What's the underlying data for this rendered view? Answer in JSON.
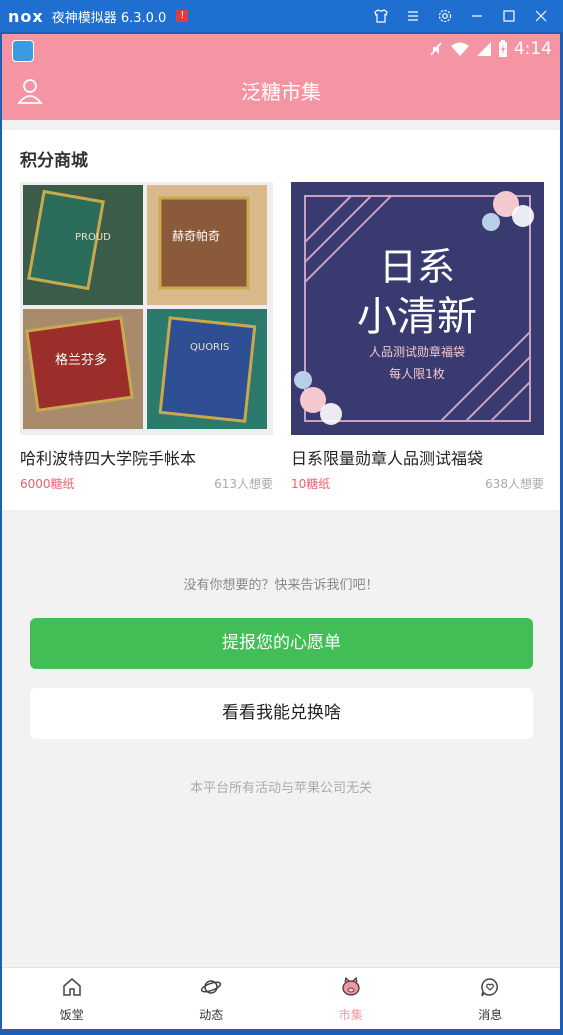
{
  "window": {
    "logo": "nox",
    "title": "夜神模拟器 6.3.0.0",
    "warn": "!",
    "buttons": [
      "shirt-icon",
      "menu-icon",
      "gear-icon",
      "minimize-icon",
      "maximize-icon",
      "close-icon"
    ]
  },
  "status": {
    "time": "4:14"
  },
  "appbar": {
    "title": "泛糖市集"
  },
  "section": {
    "title": "积分商城",
    "products": [
      {
        "name": "哈利波特四大学院手帐本",
        "price": "6000糖纸",
        "wants": "613人想要",
        "image_labels": [
          "PROUD",
          "赫奇帕奇",
          "格兰芬多",
          "QUORIS"
        ]
      },
      {
        "name": "日系限量勋章人品测试福袋",
        "price": "10糖纸",
        "wants": "638人想要",
        "poster": {
          "line1": "日系",
          "line2": "小清新",
          "line3": "人品测试勋章福袋",
          "line4": "每人限1枚"
        }
      }
    ]
  },
  "hint": "没有你想要的？快来告诉我们吧！",
  "primary_button": "提报您的心愿单",
  "secondary_button": "看看我能兑换啥",
  "footer_note": "本平台所有活动与苹果公司无关",
  "tabs": [
    {
      "label": "饭堂",
      "icon": "home-icon",
      "active": false
    },
    {
      "label": "动态",
      "icon": "planet-icon",
      "active": false
    },
    {
      "label": "市集",
      "icon": "pig-icon",
      "active": true
    },
    {
      "label": "消息",
      "icon": "message-icon",
      "active": false
    }
  ],
  "colors": {
    "accent": "#f594a3",
    "green": "#42be57",
    "price": "#f0606c",
    "titlebar": "#1f6fd1"
  }
}
